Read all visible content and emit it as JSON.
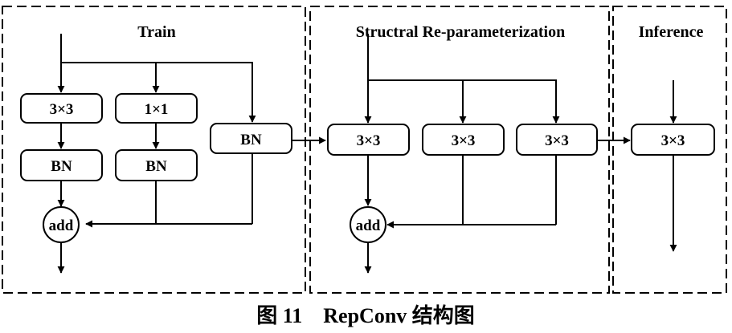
{
  "panels": {
    "train": {
      "title": "Train"
    },
    "reparam": {
      "title": "Structral Re-parameterization"
    },
    "inference": {
      "title": "Inference"
    }
  },
  "train": {
    "conv3": "3×3",
    "conv1": "1×1",
    "bn_a": "BN",
    "bn_b": "BN",
    "bn_c": "BN",
    "add": "add"
  },
  "reparam": {
    "conv_a": "3×3",
    "conv_b": "3×3",
    "conv_c": "3×3",
    "add": "add"
  },
  "inference": {
    "conv": "3×3"
  },
  "caption": "图 11    RepConv 结构图"
}
